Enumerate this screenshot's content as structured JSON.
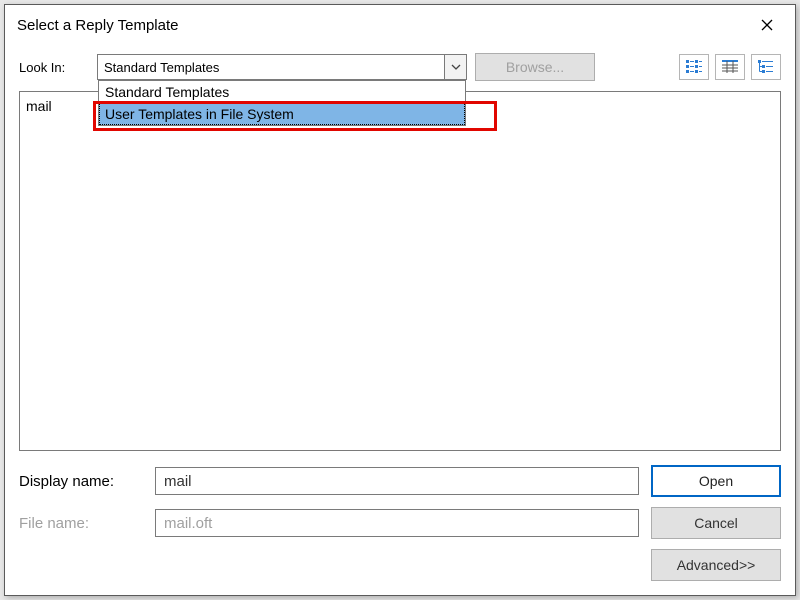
{
  "dialog": {
    "title": "Select a Reply Template"
  },
  "lookin": {
    "label": "Look In:",
    "selected": "Standard Templates",
    "options": [
      "Standard Templates",
      "User Templates in File System"
    ]
  },
  "browse": {
    "label": "Browse..."
  },
  "list": {
    "items": [
      "mail"
    ]
  },
  "displayName": {
    "label": "Display name:",
    "value": "mail"
  },
  "fileName": {
    "label": "File name:",
    "value": "mail.oft"
  },
  "buttons": {
    "open": "Open",
    "cancel": "Cancel",
    "advanced": "Advanced>>"
  }
}
